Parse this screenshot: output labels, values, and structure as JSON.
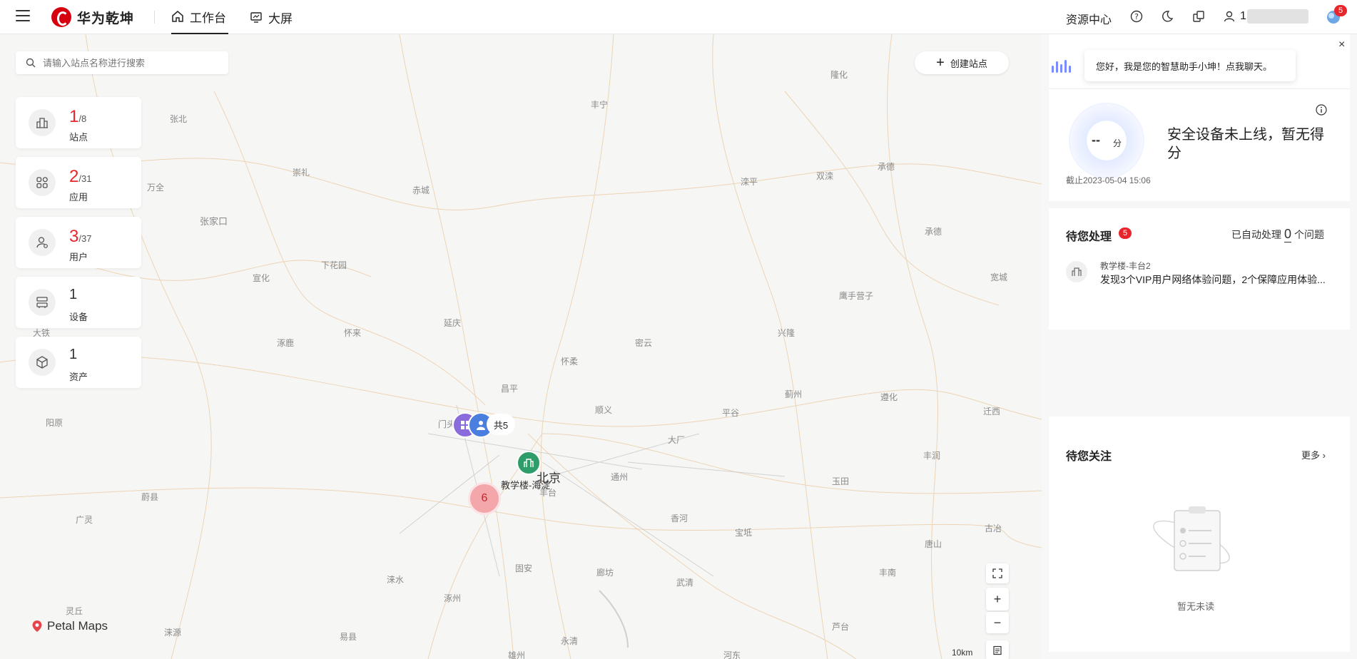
{
  "header": {
    "brand": "华为乾坤",
    "tabs": [
      {
        "label": "工作台",
        "active": true
      },
      {
        "label": "大屏",
        "active": false
      }
    ],
    "resource_center": "资源中心",
    "user_prefix": "1",
    "notification_count": "5"
  },
  "map": {
    "search_placeholder": "请输入站点名称进行搜索",
    "create_site": "创建站点",
    "stats": [
      {
        "value": "1",
        "total": "/8",
        "label": "站点",
        "highlight": true,
        "icon": "building-icon"
      },
      {
        "value": "2",
        "total": "/31",
        "label": "应用",
        "highlight": true,
        "icon": "apps-icon"
      },
      {
        "value": "3",
        "total": "/37",
        "label": "用户",
        "highlight": true,
        "icon": "user-icon"
      },
      {
        "value": "1",
        "total": "",
        "label": "设备",
        "highlight": false,
        "icon": "device-icon"
      },
      {
        "value": "1",
        "total": "",
        "label": "资产",
        "highlight": false,
        "icon": "asset-icon"
      }
    ],
    "cluster_total": "共5",
    "cluster_count": "6",
    "site_label": "教学楼-海淀",
    "city_label": "北京",
    "places": [
      "隆化",
      "张北",
      "丰宁",
      "承德",
      "崇礼",
      "万全",
      "赤城",
      "滦平",
      "双滦",
      "张家口",
      "承德",
      "宽城",
      "下花园",
      "宣化",
      "鹰手营子",
      "延庆",
      "怀来",
      "兴隆",
      "涿鹿",
      "密云",
      "怀柔",
      "大铁",
      "蓟州",
      "昌平",
      "顺义",
      "遵化",
      "平谷",
      "阳原",
      "门头沟",
      "迁西",
      "大厂",
      "丰润",
      "通州",
      "玉田",
      "蔚县",
      "丰台",
      "广灵",
      "香河",
      "宝坻",
      "唐山",
      "固安",
      "廊坊",
      "古冶",
      "涞水",
      "武清",
      "丰南",
      "涿州",
      "灵丘",
      "涞源",
      "芦台",
      "易县",
      "永清",
      "雄州",
      "河东"
    ],
    "scale": "10km",
    "provider": "Petal Maps"
  },
  "right_panel": {
    "assistant_text": "您好，我是您的智慧助手小坤！点我聊天。",
    "score_value": "--",
    "score_unit": "分",
    "score_message": "安全设备未上线，暂无得分",
    "score_date": "截止2023-05-04 15:06",
    "pending": {
      "title": "待您处理",
      "count": "5",
      "auto_text_prefix": "已自动处理",
      "auto_count": "0",
      "auto_text_suffix": "个问题",
      "item_site": "教学楼-丰台2",
      "item_desc": "发现3个VIP用户网络体验问题，2个保障应用体验..."
    },
    "attention": {
      "title": "待您关注",
      "more": "更多",
      "empty_text": "暂无未读"
    }
  },
  "colors": {
    "accent_red": "#e7262c",
    "brand_red": "#d7000f",
    "map_bg": "#f6f6f5"
  }
}
